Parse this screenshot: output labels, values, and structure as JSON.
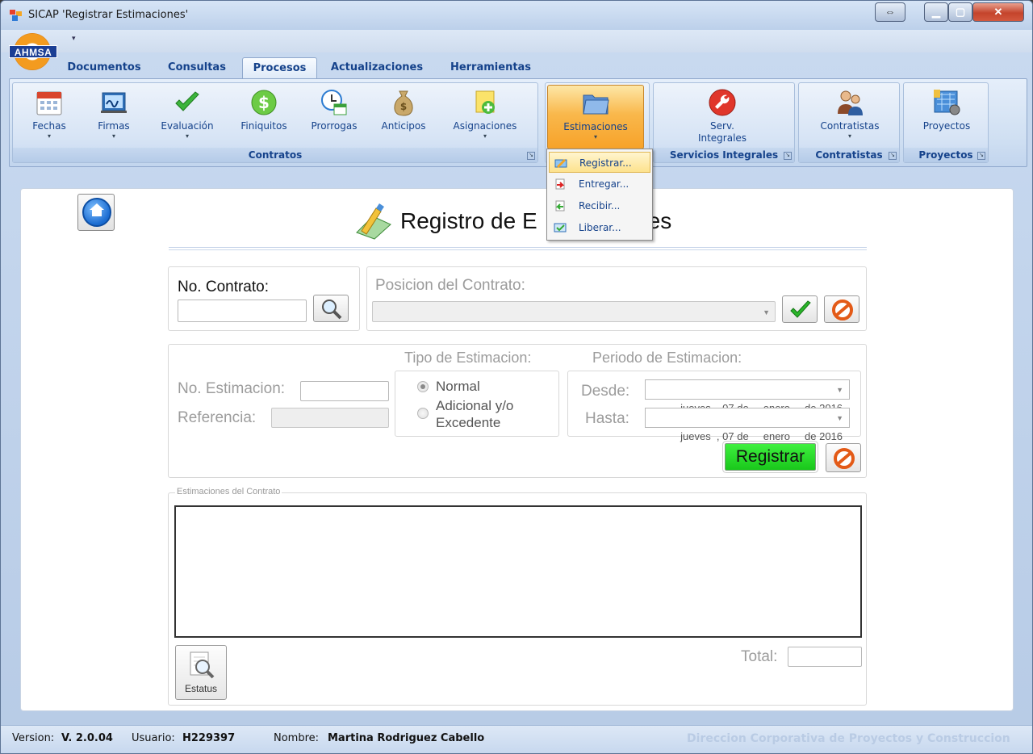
{
  "window": {
    "title": "SICAP 'Registrar Estimaciones'",
    "controls": [
      "restore",
      "minimize",
      "maximize",
      "close"
    ]
  },
  "logo": {
    "text": "AHMSA"
  },
  "tabs": [
    {
      "label": "Documentos",
      "active": false
    },
    {
      "label": "Consultas",
      "active": false
    },
    {
      "label": "Procesos",
      "active": true
    },
    {
      "label": "Actualizaciones",
      "active": false
    },
    {
      "label": "Herramientas",
      "active": false
    }
  ],
  "ribbon": {
    "groups": {
      "contratos": {
        "label": "Contratos",
        "buttons": [
          {
            "label": "Fechas",
            "icon": "calendar-icon",
            "dropdown": true
          },
          {
            "label": "Firmas",
            "icon": "signature-icon",
            "dropdown": true
          },
          {
            "label": "Evaluación",
            "icon": "checkmark-icon",
            "dropdown": true
          },
          {
            "label": "Finiquitos",
            "icon": "dollar-coin-icon",
            "dropdown": false
          },
          {
            "label": "Prorrogas",
            "icon": "clock-calendar-icon",
            "dropdown": false
          },
          {
            "label": "Anticipos",
            "icon": "money-bag-icon",
            "dropdown": false
          },
          {
            "label": "Asignaciones",
            "icon": "add-note-icon",
            "dropdown": true
          }
        ]
      },
      "estimaciones": {
        "label": "",
        "button": {
          "label": "Estimaciones",
          "icon": "folder-icon",
          "dropdown": true
        }
      },
      "servicios": {
        "label": "Servicios Integrales",
        "button": {
          "label1": "Serv.",
          "label2": "Integrales",
          "icon": "wrench-icon"
        }
      },
      "contratistas": {
        "label": "Contratistas",
        "button": {
          "label": "Contratistas",
          "icon": "people-icon",
          "dropdown": true
        }
      },
      "proyectos": {
        "label": "Proyectos",
        "button": {
          "label": "Proyectos",
          "icon": "blueprint-icon"
        }
      }
    }
  },
  "menu": {
    "items": [
      {
        "label": "Registrar...",
        "icon": "register-icon",
        "highlighted": true
      },
      {
        "label": "Entregar...",
        "icon": "deliver-icon",
        "highlighted": false
      },
      {
        "label": "Recibir...",
        "icon": "receive-icon",
        "highlighted": false
      },
      {
        "label": "Liberar...",
        "icon": "release-icon",
        "highlighted": false
      }
    ]
  },
  "page": {
    "title": "Registro de E",
    "title_tail": "es"
  },
  "contract": {
    "no_contrato_label": "No. Contrato:",
    "no_contrato_value": "",
    "posicion_label": "Posicion del Contrato:",
    "posicion_value": ""
  },
  "estimation": {
    "no_estimacion_label": "No. Estimacion:",
    "no_estimacion_value": "",
    "referencia_label": "Referencia:",
    "referencia_value": "",
    "tipo_label": "Tipo de Estimacion:",
    "tipo_options": [
      {
        "label": "Normal",
        "selected": true
      },
      {
        "label": "Adicional y/o",
        "label2": "Excedente",
        "selected": false
      }
    ],
    "periodo_label": "Periodo de Estimacion:",
    "desde_label": "Desde:",
    "hasta_label": "Hasta:",
    "desde_value": "jueves  , 07 de     enero     de 2016",
    "hasta_value": "jueves  , 07 de     enero     de 2016",
    "registrar_label": "Registrar"
  },
  "list": {
    "legend": "Estimaciones del Contrato",
    "rows": [],
    "estatus_label": "Estatus",
    "total_label": "Total:",
    "total_value": ""
  },
  "statusbar": {
    "version_label": "Version:",
    "version_value": "V. 2.0.04",
    "usuario_label": "Usuario:",
    "usuario_value": "H229397",
    "nombre_label": "Nombre:",
    "nombre_value": "Martina Rodriguez Cabello",
    "department": "Direccion Corporativa de Proyectos y Construccion"
  },
  "colors": {
    "ribbon_text": "#15428b",
    "registrar_green": "#22d322",
    "selected_orange": "#f7a229"
  }
}
